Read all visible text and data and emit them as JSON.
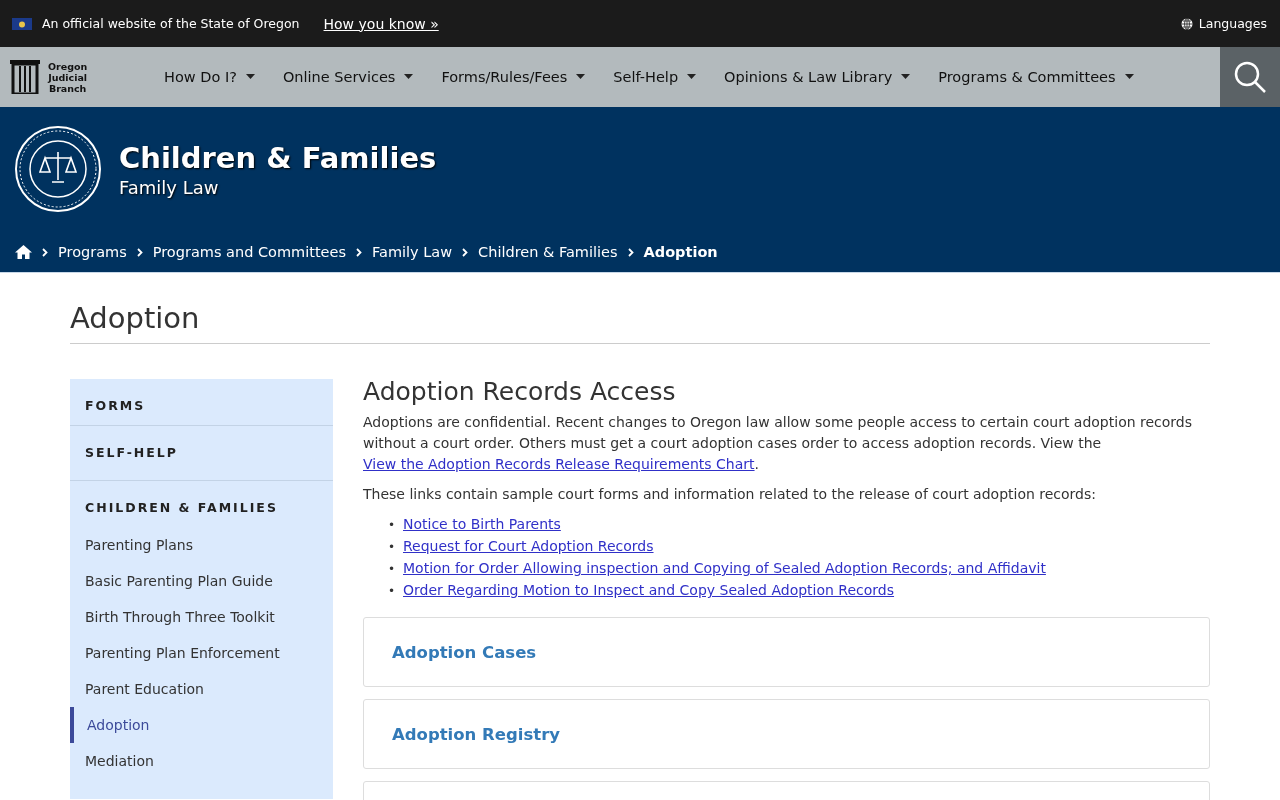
{
  "gov_banner": {
    "text": "An official website of the State of Oregon",
    "link": "How you know »",
    "languages": "Languages"
  },
  "nav": {
    "logo_text": [
      "Oregon",
      "Judicial",
      "Branch"
    ],
    "items": [
      {
        "label": "How Do I?"
      },
      {
        "label": "Online Services"
      },
      {
        "label": "Forms/Rules/Fees"
      },
      {
        "label": "Self-Help"
      },
      {
        "label": "Opinions & Law Library"
      },
      {
        "label": "Programs & Committees"
      }
    ]
  },
  "header": {
    "title": "Children & Families",
    "subtitle": "Family Law"
  },
  "breadcrumbs": [
    {
      "label": "Programs",
      "current": false
    },
    {
      "label": "Programs and Committees",
      "current": false
    },
    {
      "label": "Family Law",
      "current": false
    },
    {
      "label": "Children & Families",
      "current": false
    },
    {
      "label": "Adoption",
      "current": true
    }
  ],
  "page_title": "Adoption",
  "sidebar": {
    "items": [
      {
        "kind": "heading",
        "label": "FORMS"
      },
      {
        "kind": "heading",
        "label": "SELF-HELP"
      },
      {
        "kind": "heading",
        "label": "CHILDREN & FAMILIES"
      },
      {
        "kind": "link",
        "label": "Parenting Plans",
        "selected": false
      },
      {
        "kind": "link",
        "label": "Basic Parenting Plan Guide",
        "selected": false
      },
      {
        "kind": "link",
        "label": "Birth Through Three Toolkit",
        "selected": false
      },
      {
        "kind": "link",
        "label": "Parenting Plan Enforcement",
        "selected": false
      },
      {
        "kind": "link",
        "label": "Parent Education",
        "selected": false
      },
      {
        "kind": "link",
        "label": "Adoption",
        "selected": true
      },
      {
        "kind": "link",
        "label": "Mediation",
        "selected": false
      }
    ]
  },
  "main": {
    "heading": "Adoption Records Access",
    "intro": {
      "text": "Adoptions are confidential. Recent changes to Oregon law allow some people access to certain court adoption records without a court order. Others must get a court adoption cases order to access adoption records. View the ",
      "link": "View the Adoption Records Release Requirements Chart",
      "after": "."
    },
    "lead": "These links contain sample court forms and information related to the release of court adoption records:",
    "links": [
      {
        "marker": "•",
        "label": "Notice to Birth Parents"
      },
      {
        "marker": "•",
        "label": "Request for Court Adoption Records"
      },
      {
        "marker": "•",
        "label": "Motion for Order Allowing inspection and Copying of Sealed Adoption Records; and Affidavit"
      },
      {
        "marker": "•",
        "label": "Order Regarding Motion to Inspect and Copy Sealed Adoption Records"
      }
    ],
    "panels": [
      {
        "kind": "titled",
        "title": "Adoption Cases"
      },
      {
        "kind": "titled",
        "title": "Adoption Registry"
      },
      {
        "kind": "empty"
      }
    ]
  }
}
